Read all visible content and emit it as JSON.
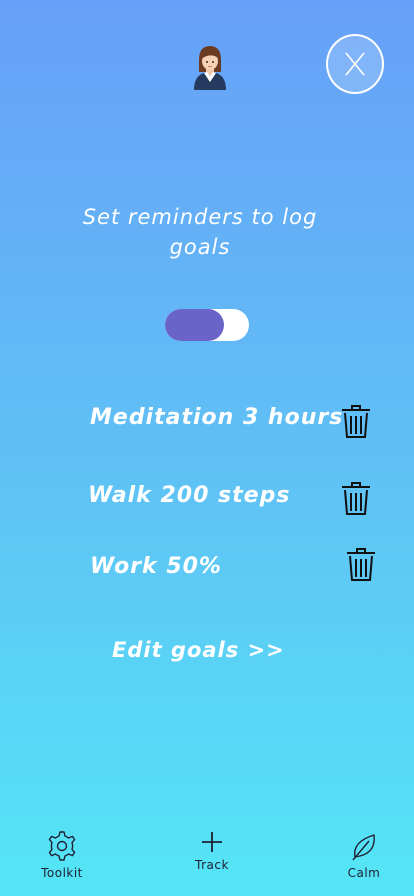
{
  "header": {
    "avatar_icon": "businesswoman-avatar-icon",
    "close_icon": "close-icon"
  },
  "reminder": {
    "heading": "Set reminders to log goals",
    "toggle_on": true,
    "toggle_color": "#6b64c8"
  },
  "goals": [
    {
      "label": "Meditation 3 hours",
      "icon": "trash-icon"
    },
    {
      "label": "Walk 200 steps",
      "icon": "trash-icon"
    },
    {
      "label": "Work 50%",
      "icon": "trash-icon"
    }
  ],
  "edit_goals_label": "Edit goals >>",
  "bottom_nav": [
    {
      "label": "Toolkit",
      "icon": "gear-icon"
    },
    {
      "label": "Track",
      "icon": "plus-icon"
    },
    {
      "label": "Calm",
      "icon": "leaf-icon"
    }
  ],
  "colors": {
    "gradient_top": "#67a0f8",
    "gradient_bottom": "#54e6f6",
    "text": "#ffffff",
    "nav_text": "#1f1f33"
  }
}
